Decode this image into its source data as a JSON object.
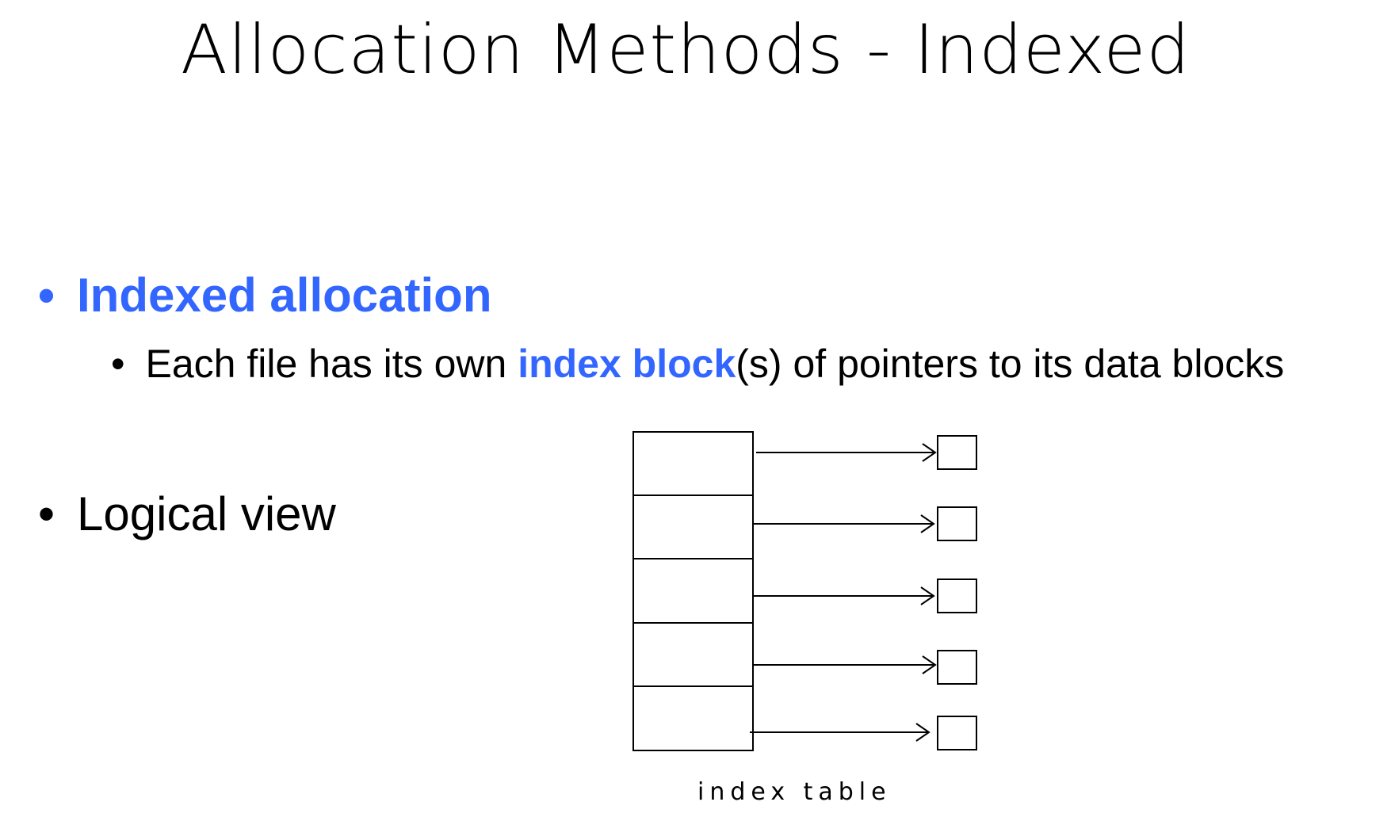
{
  "title": "Allocation Methods - Indexed",
  "accent_color": "#3366ff",
  "bullets": {
    "indexed": {
      "marker": "•",
      "label": "Indexed allocation"
    },
    "sub": {
      "marker": "•",
      "text_before": "Each file has its own ",
      "highlight": "index block",
      "text_after": "(s) of pointers to its data blocks"
    },
    "logical": {
      "marker": "•",
      "label": "Logical view"
    }
  },
  "diagram": {
    "index_table_entries": 5,
    "data_blocks": 5,
    "caption": "index table"
  }
}
